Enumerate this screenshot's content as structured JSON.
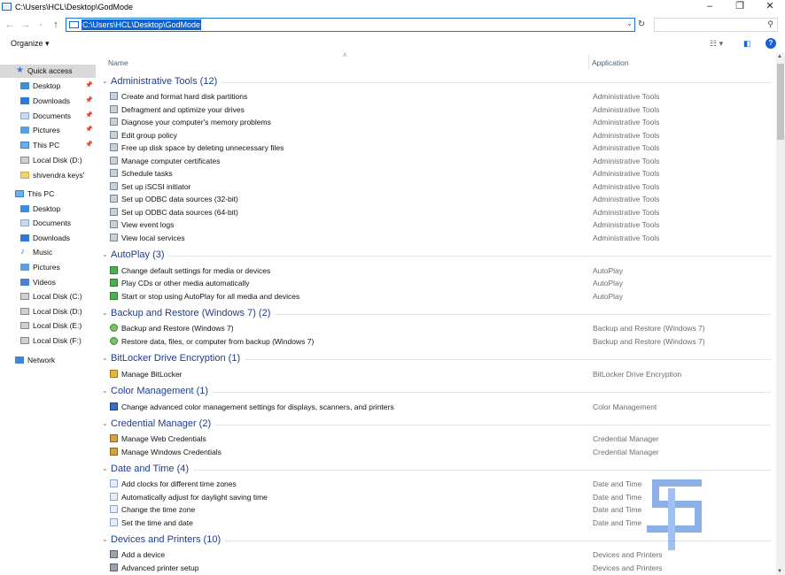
{
  "window": {
    "title": "C:\\Users\\HCL\\Desktop\\GodMode"
  },
  "address": {
    "path": "C:\\Users\\HCL\\Desktop\\GodMode"
  },
  "toolbar": {
    "organize_label": "Organize ▾"
  },
  "columns": {
    "name": "Name",
    "application": "Application"
  },
  "sidebar": {
    "items": [
      {
        "label": "Quick access",
        "icon": "star-icon"
      },
      {
        "label": "Desktop",
        "icon": "desktop-icon",
        "pinned": true
      },
      {
        "label": "Downloads",
        "icon": "downloads-icon",
        "pinned": true
      },
      {
        "label": "Documents",
        "icon": "documents-icon",
        "pinned": true
      },
      {
        "label": "Pictures",
        "icon": "pictures-icon",
        "pinned": true
      },
      {
        "label": "This PC",
        "icon": "pc-icon",
        "pinned": true
      },
      {
        "label": "Local Disk (D:)",
        "icon": "disk-icon"
      },
      {
        "label": "shivendra keys'",
        "icon": "folder-icon"
      },
      {
        "label": "This PC",
        "icon": "pc-icon"
      },
      {
        "label": "Desktop",
        "icon": "desktop-icon"
      },
      {
        "label": "Documents",
        "icon": "documents-icon"
      },
      {
        "label": "Downloads",
        "icon": "downloads-icon"
      },
      {
        "label": "Music",
        "icon": "music-icon"
      },
      {
        "label": "Pictures",
        "icon": "pictures-icon"
      },
      {
        "label": "Videos",
        "icon": "videos-icon"
      },
      {
        "label": "Local Disk (C:)",
        "icon": "disk-icon"
      },
      {
        "label": "Local Disk (D:)",
        "icon": "disk-icon"
      },
      {
        "label": "Local Disk (E:)",
        "icon": "disk-icon"
      },
      {
        "label": "Local Disk (F:)",
        "icon": "disk-icon"
      },
      {
        "label": "Network",
        "icon": "network-icon"
      }
    ]
  },
  "groups": [
    {
      "title": "Administrative Tools (12)",
      "icon": "admin-tools-icon",
      "items": [
        {
          "name": "Create and format hard disk partitions",
          "app": "Administrative Tools"
        },
        {
          "name": "Defragment and optimize your drives",
          "app": "Administrative Tools"
        },
        {
          "name": "Diagnose your computer's memory problems",
          "app": "Administrative Tools"
        },
        {
          "name": "Edit group policy",
          "app": "Administrative Tools"
        },
        {
          "name": "Free up disk space by deleting unnecessary files",
          "app": "Administrative Tools"
        },
        {
          "name": "Manage computer certificates",
          "app": "Administrative Tools"
        },
        {
          "name": "Schedule tasks",
          "app": "Administrative Tools"
        },
        {
          "name": "Set up iSCSI initiator",
          "app": "Administrative Tools"
        },
        {
          "name": "Set up ODBC data sources (32-bit)",
          "app": "Administrative Tools"
        },
        {
          "name": "Set up ODBC data sources (64-bit)",
          "app": "Administrative Tools"
        },
        {
          "name": "View event logs",
          "app": "Administrative Tools"
        },
        {
          "name": "View local services",
          "app": "Administrative Tools"
        }
      ]
    },
    {
      "title": "AutoPlay (3)",
      "icon": "autoplay-icon",
      "items": [
        {
          "name": "Change default settings for media or devices",
          "app": "AutoPlay"
        },
        {
          "name": "Play CDs or other media automatically",
          "app": "AutoPlay"
        },
        {
          "name": "Start or stop using AutoPlay for all media and devices",
          "app": "AutoPlay"
        }
      ]
    },
    {
      "title": "Backup and Restore (Windows 7) (2)",
      "icon": "backup-icon",
      "items": [
        {
          "name": "Backup and Restore (Windows 7)",
          "app": "Backup and Restore (Windows 7)"
        },
        {
          "name": "Restore data, files, or computer from backup (Windows 7)",
          "app": "Backup and Restore (Windows 7)"
        }
      ]
    },
    {
      "title": "BitLocker Drive Encryption (1)",
      "icon": "bitlocker-icon",
      "items": [
        {
          "name": "Manage BitLocker",
          "app": "BitLocker Drive Encryption"
        }
      ]
    },
    {
      "title": "Color Management (1)",
      "icon": "color-management-icon",
      "items": [
        {
          "name": "Change advanced color management settings for displays, scanners, and printers",
          "app": "Color Management"
        }
      ]
    },
    {
      "title": "Credential Manager (2)",
      "icon": "credential-icon",
      "items": [
        {
          "name": "Manage Web Credentials",
          "app": "Credential Manager"
        },
        {
          "name": "Manage Windows Credentials",
          "app": "Credential Manager"
        }
      ]
    },
    {
      "title": "Date and Time (4)",
      "icon": "clock-icon",
      "items": [
        {
          "name": "Add clocks for different time zones",
          "app": "Date and Time"
        },
        {
          "name": "Automatically adjust for daylight saving time",
          "app": "Date and Time"
        },
        {
          "name": "Change the time zone",
          "app": "Date and Time"
        },
        {
          "name": "Set the time and date",
          "app": "Date and Time"
        }
      ]
    },
    {
      "title": "Devices and Printers (10)",
      "icon": "printer-icon",
      "items": [
        {
          "name": "Add a device",
          "app": "Devices and Printers"
        },
        {
          "name": "Advanced printer setup",
          "app": "Devices and Printers"
        }
      ]
    }
  ],
  "colors": {
    "accent": "#1a73d0",
    "group_title": "#1e3d8e",
    "selection": "#0a64d6"
  }
}
